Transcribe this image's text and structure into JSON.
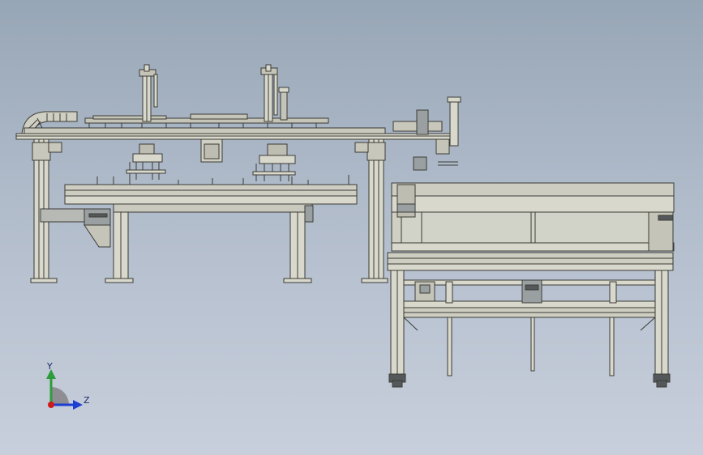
{
  "triad": {
    "y_label": "Y",
    "z_label": "Z",
    "y_color": "#2e9c3a",
    "z_color": "#1d3fd1",
    "x_color": "#d01a1a"
  },
  "colors": {
    "steel_fill": "#d8d8cc",
    "steel_line": "#3b3b36",
    "dark_part": "#55585a"
  }
}
